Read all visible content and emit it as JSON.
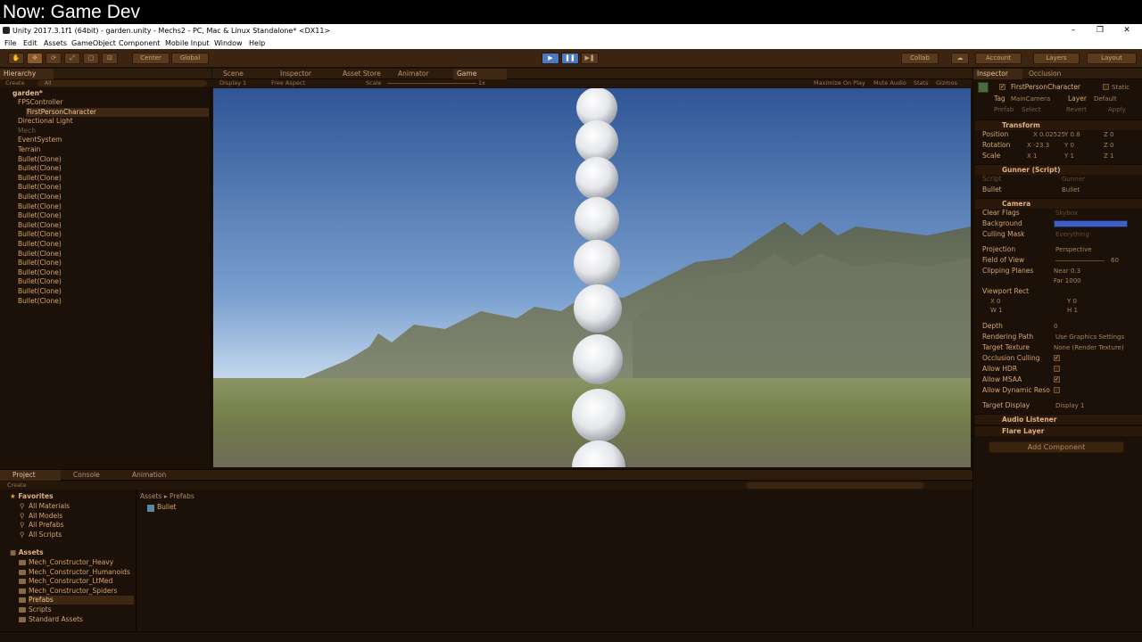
{
  "overlay": {
    "title": "Now: Game Dev"
  },
  "window": {
    "title": "Unity 2017.3.1f1 (64bit) - garden.unity - Mechs2 - PC, Mac & Linux Standalone* <DX11>",
    "minimize": "–",
    "restore": "❐",
    "close": "✕"
  },
  "menu": [
    "File",
    "Edit",
    "Assets",
    "GameObject",
    "Component",
    "Mobile Input",
    "Window",
    "Help"
  ],
  "toolbar": {
    "pivot": "Center",
    "space": "Global",
    "collab": "Collab",
    "account": "Account",
    "layers": "Layers",
    "layout": "Layout"
  },
  "hierarchy": {
    "tab": "Hierarchy",
    "create": "Create",
    "search": "All",
    "scene": "garden*",
    "items": [
      {
        "label": "FPSController",
        "indent": 1,
        "state": "normal"
      },
      {
        "label": "FirstPersonCharacter",
        "indent": 2,
        "state": "selected"
      },
      {
        "label": "Directional Light",
        "indent": 1,
        "state": "normal"
      },
      {
        "label": "Mech",
        "indent": 1,
        "state": "dim"
      },
      {
        "label": "EventSystem",
        "indent": 1,
        "state": "normal"
      },
      {
        "label": "Terrain",
        "indent": 1,
        "state": "normal"
      },
      {
        "label": "Bullet(Clone)",
        "indent": 1,
        "state": "normal"
      },
      {
        "label": "Bullet(Clone)",
        "indent": 1,
        "state": "normal"
      },
      {
        "label": "Bullet(Clone)",
        "indent": 1,
        "state": "normal"
      },
      {
        "label": "Bullet(Clone)",
        "indent": 1,
        "state": "normal"
      },
      {
        "label": "Bullet(Clone)",
        "indent": 1,
        "state": "normal"
      },
      {
        "label": "Bullet(Clone)",
        "indent": 1,
        "state": "normal"
      },
      {
        "label": "Bullet(Clone)",
        "indent": 1,
        "state": "normal"
      },
      {
        "label": "Bullet(Clone)",
        "indent": 1,
        "state": "normal"
      },
      {
        "label": "Bullet(Clone)",
        "indent": 1,
        "state": "normal"
      },
      {
        "label": "Bullet(Clone)",
        "indent": 1,
        "state": "normal"
      },
      {
        "label": "Bullet(Clone)",
        "indent": 1,
        "state": "normal"
      },
      {
        "label": "Bullet(Clone)",
        "indent": 1,
        "state": "normal"
      },
      {
        "label": "Bullet(Clone)",
        "indent": 1,
        "state": "normal"
      },
      {
        "label": "Bullet(Clone)",
        "indent": 1,
        "state": "normal"
      },
      {
        "label": "Bullet(Clone)",
        "indent": 1,
        "state": "normal"
      },
      {
        "label": "Bullet(Clone)",
        "indent": 1,
        "state": "normal"
      }
    ]
  },
  "center_tabs": [
    "Scene",
    "Inspector",
    "Asset Store",
    "Animator",
    "Game"
  ],
  "game_bar": {
    "display": "Display 1",
    "aspect": "Free Aspect",
    "scale_label": "Scale",
    "scale_value": "1x",
    "maximize": "Maximize On Play",
    "mute": "Mute Audio",
    "stats": "Stats",
    "gizmos": "Gizmos"
  },
  "inspector": {
    "tab": "Inspector",
    "tab2": "Occlusion",
    "object_name": "FirstPersonCharacter",
    "static": "Static",
    "tag_label": "Tag",
    "tag_value": "MainCamera",
    "layer_label": "Layer",
    "layer_value": "Default",
    "prefab": "Prefab",
    "select": "Select",
    "revert": "Revert",
    "apply": "Apply",
    "transform": {
      "title": "Transform",
      "position": {
        "label": "Position",
        "x": "0.02525",
        "y": "0.8",
        "z": "0"
      },
      "rotation": {
        "label": "Rotation",
        "x": "-23.3",
        "y": "0",
        "z": "0"
      },
      "scale": {
        "label": "Scale",
        "x": "1",
        "y": "1",
        "z": "1"
      }
    },
    "gunner": {
      "title": "Gunner (Script)",
      "script_label": "Script",
      "script_value": "Gunner",
      "bullet_label": "Bullet",
      "bullet_value": "Bullet"
    },
    "camera": {
      "title": "Camera",
      "clear_flags": {
        "label": "Clear Flags",
        "value": "Skybox"
      },
      "background": {
        "label": "Background"
      },
      "culling_mask": {
        "label": "Culling Mask",
        "value": "Everything"
      },
      "projection": {
        "label": "Projection",
        "value": "Perspective"
      },
      "fov": {
        "label": "Field of View",
        "value": "60"
      },
      "clipping": {
        "label": "Clipping Planes",
        "near_label": "Near",
        "near": "0.3",
        "far_label": "Far",
        "far": "1000"
      },
      "viewport": {
        "label": "Viewport Rect",
        "x": "0",
        "y": "0",
        "w": "1",
        "h": "1"
      },
      "depth": {
        "label": "Depth",
        "value": "0"
      },
      "rendering_path": {
        "label": "Rendering Path",
        "value": "Use Graphics Settings"
      },
      "target_texture": {
        "label": "Target Texture",
        "value": "None (Render Texture)"
      },
      "occlusion": {
        "label": "Occlusion Culling",
        "checked": true
      },
      "hdr": {
        "label": "Allow HDR",
        "checked": false
      },
      "msaa": {
        "label": "Allow MSAA",
        "checked": true
      },
      "dynres": {
        "label": "Allow Dynamic Reso",
        "checked": false
      },
      "target_display": {
        "label": "Target Display",
        "value": "Display 1"
      }
    },
    "audio_listener": "Audio Listener",
    "flare_layer": "Flare Layer",
    "add_component": "Add Component"
  },
  "project": {
    "tabs": [
      "Project",
      "Console",
      "Animation"
    ],
    "create": "Create",
    "favorites_title": "Favorites",
    "favorites": [
      "All Materials",
      "All Models",
      "All Prefabs",
      "All Scripts"
    ],
    "assets_title": "Assets",
    "folders": [
      "Mech_Constructor_Heavy",
      "Mech_Constructor_Humanoids",
      "Mech_Constructor_LtMed",
      "Mech_Constructor_Spiders",
      "Prefabs",
      "Scripts",
      "Standard Assets"
    ],
    "breadcrumb_root": "Assets",
    "breadcrumb_sep": "▸",
    "breadcrumb_current": "Prefabs",
    "files": [
      "Bullet"
    ]
  },
  "colors": {
    "accent": "#3e60c8",
    "text": "#d9a36a",
    "bg": "#1c1108"
  }
}
